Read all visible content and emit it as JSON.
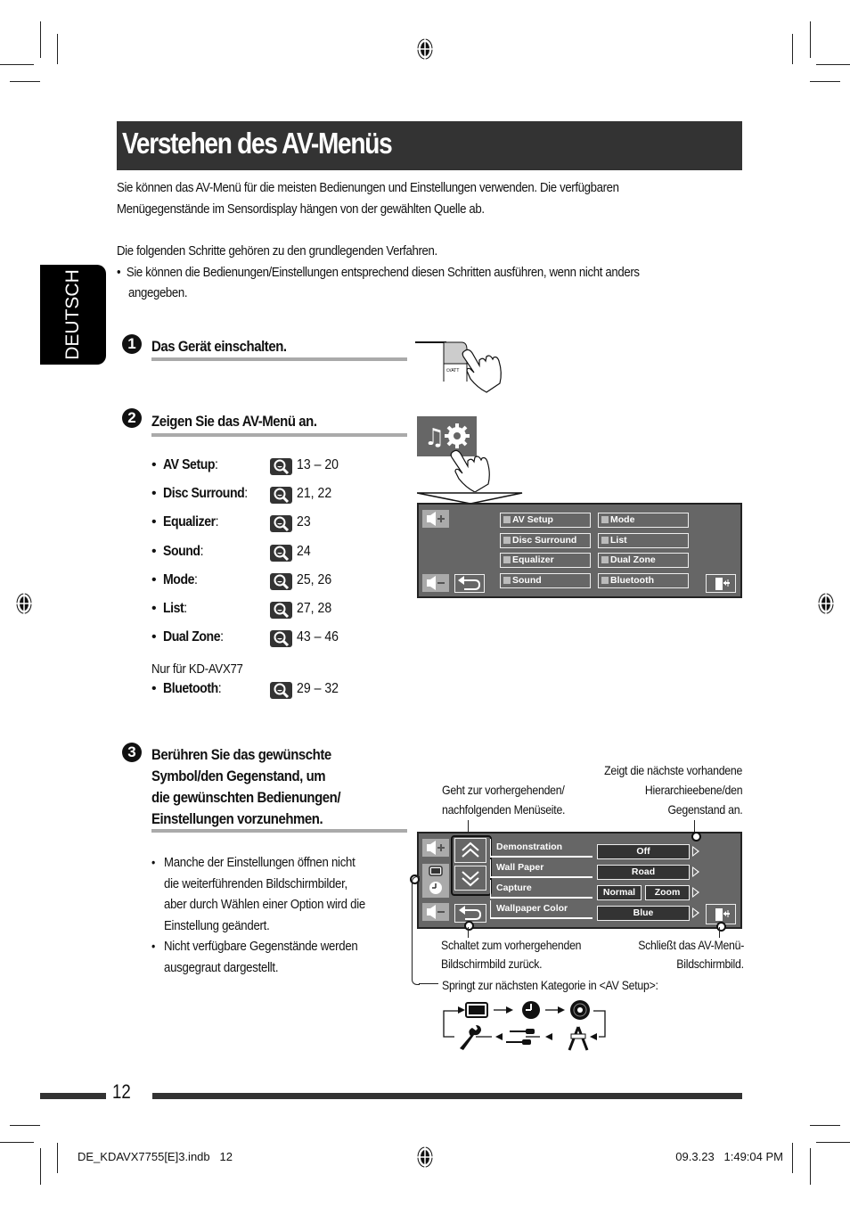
{
  "header": {
    "title": "Verstehen des AV-Menüs",
    "lang_tab": "DEUTSCH"
  },
  "intro": {
    "line1": "Sie können das AV-Menü für die meisten Bedienungen und Einstellungen verwenden. Die verfügbaren",
    "line2": "Menügegenstände im Sensordisplay hängen von der gewählten Quelle ab.",
    "line3": "Die folgenden Schritte gehören zu den grundlegenden Verfahren.",
    "bullet_line1": "Sie können die Bedienungen/Einstellungen entsprechend diesen Schritten ausführen, wenn nicht anders",
    "bullet_line2": "angegeben."
  },
  "steps": [
    {
      "number": "1",
      "heading": "Das Gerät einschalten.",
      "button_label": "⏻/ATT"
    },
    {
      "number": "2",
      "heading": "Zeigen Sie das AV-Menü an."
    },
    {
      "number": "3",
      "heading_lines": [
        "Berühren Sie das gewünschte",
        "Symbol/den Gegenstand, um",
        "die gewünschten Bedienungen/",
        "Einstellungen vorzunehmen."
      ]
    }
  ],
  "references": [
    {
      "label": "AV Setup",
      "pages": "13 – 20"
    },
    {
      "label": "Disc Surround",
      "pages": "21, 22"
    },
    {
      "label": "Equalizer",
      "pages": "23"
    },
    {
      "label": "Sound",
      "pages": "24"
    },
    {
      "label": "Mode",
      "pages": "25, 26"
    },
    {
      "label": "List",
      "pages": "27, 28"
    },
    {
      "label": "Dual Zone",
      "pages": "43 – 46"
    }
  ],
  "model_note": "Nur für KD-AVX77",
  "bluetooth_ref": {
    "label": "Bluetooth",
    "pages": "29 – 32"
  },
  "av_menu_screen": {
    "left_column": [
      "AV Setup",
      "Disc Surround",
      "Equalizer",
      "Sound"
    ],
    "right_column": [
      "Mode",
      "List",
      "Dual Zone",
      "Bluetooth"
    ]
  },
  "setup_screen": {
    "rows": [
      {
        "label": "Demonstration",
        "values": [
          "Off"
        ]
      },
      {
        "label": "Wall Paper",
        "values": [
          "Road"
        ]
      },
      {
        "label": "Capture",
        "values": [
          "Normal",
          "Zoom"
        ]
      },
      {
        "label": "Wallpaper Color",
        "values": [
          "Blue"
        ]
      }
    ]
  },
  "callouts": {
    "page_nav": "Geht zur vorhergehenden/\nnachfolgenden Menüseite.",
    "page_nav_1": "Geht zur vorhergehenden/",
    "page_nav_2": "nachfolgenden Menüseite.",
    "next_level_1": "Zeigt die nächste vorhandene",
    "next_level_2": "Hierarchieebene/den",
    "next_level_3": "Gegenstand an.",
    "back_1": "Schaltet zum vorhergehenden",
    "back_2": "Bildschirmbild zurück.",
    "close_1": "Schließt das AV-Menü-",
    "close_2": "Bildschirmbild.",
    "category": "Springt zur nächsten Kategorie in <AV Setup>:"
  },
  "category_cycle": [
    "display-icon",
    "clock-icon",
    "disc-icon",
    "compass-icon",
    "cables-icon",
    "wrench-icon"
  ],
  "step3_notes": [
    [
      "Manche der Einstellungen öffnen nicht",
      "die weiterführenden Bildschirmbilder,",
      "aber durch Wählen einer Option wird die",
      "Einstellung geändert."
    ],
    [
      "Nicht verfügbare Gegenstände werden",
      "ausgegraut dargestellt."
    ]
  ],
  "footer": {
    "page_number": "12",
    "file_info": "DE_KDAVX7755[E]3.indb   12",
    "timestamp": "09.3.23   1:49:04 PM"
  }
}
